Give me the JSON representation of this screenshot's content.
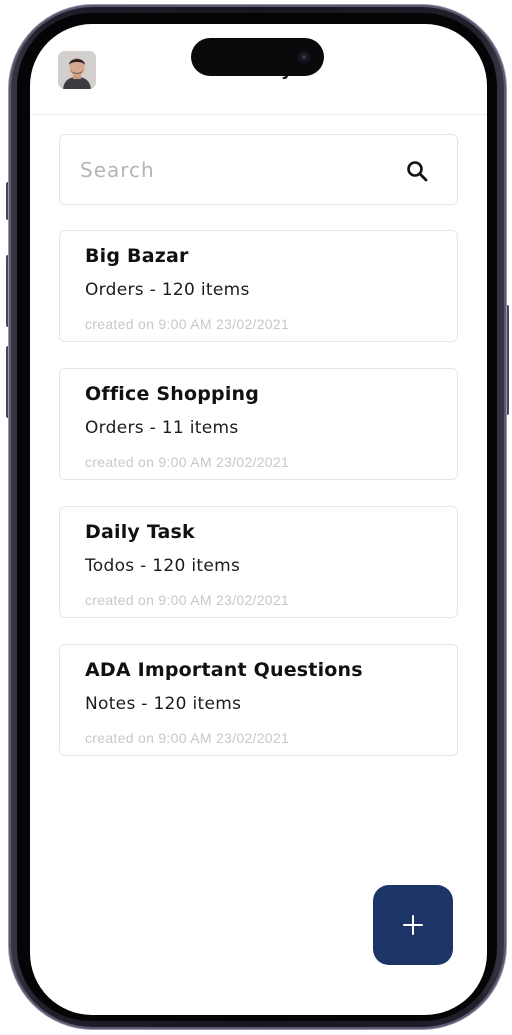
{
  "header": {
    "title": "Lately",
    "avatar_alt": "profile photo"
  },
  "search": {
    "placeholder": "Search",
    "value": ""
  },
  "lists": [
    {
      "title": "Big Bazar",
      "subtitle": "Orders - 120 items",
      "created": "created on 9:00 AM 23/02/2021"
    },
    {
      "title": "Office Shopping",
      "subtitle": "Orders - 11 items",
      "created": "created on 9:00 AM 23/02/2021"
    },
    {
      "title": "Daily Task",
      "subtitle": "Todos - 120 items",
      "created": "created on 9:00 AM 23/02/2021"
    },
    {
      "title": "ADA Important Questions",
      "subtitle": "Notes - 120 items",
      "created": "created on 9:00 AM 23/02/2021"
    }
  ],
  "fab": {
    "icon": "plus-icon",
    "color": "#1c3566"
  },
  "icons": {
    "search": "search-icon",
    "avatar": "avatar"
  }
}
